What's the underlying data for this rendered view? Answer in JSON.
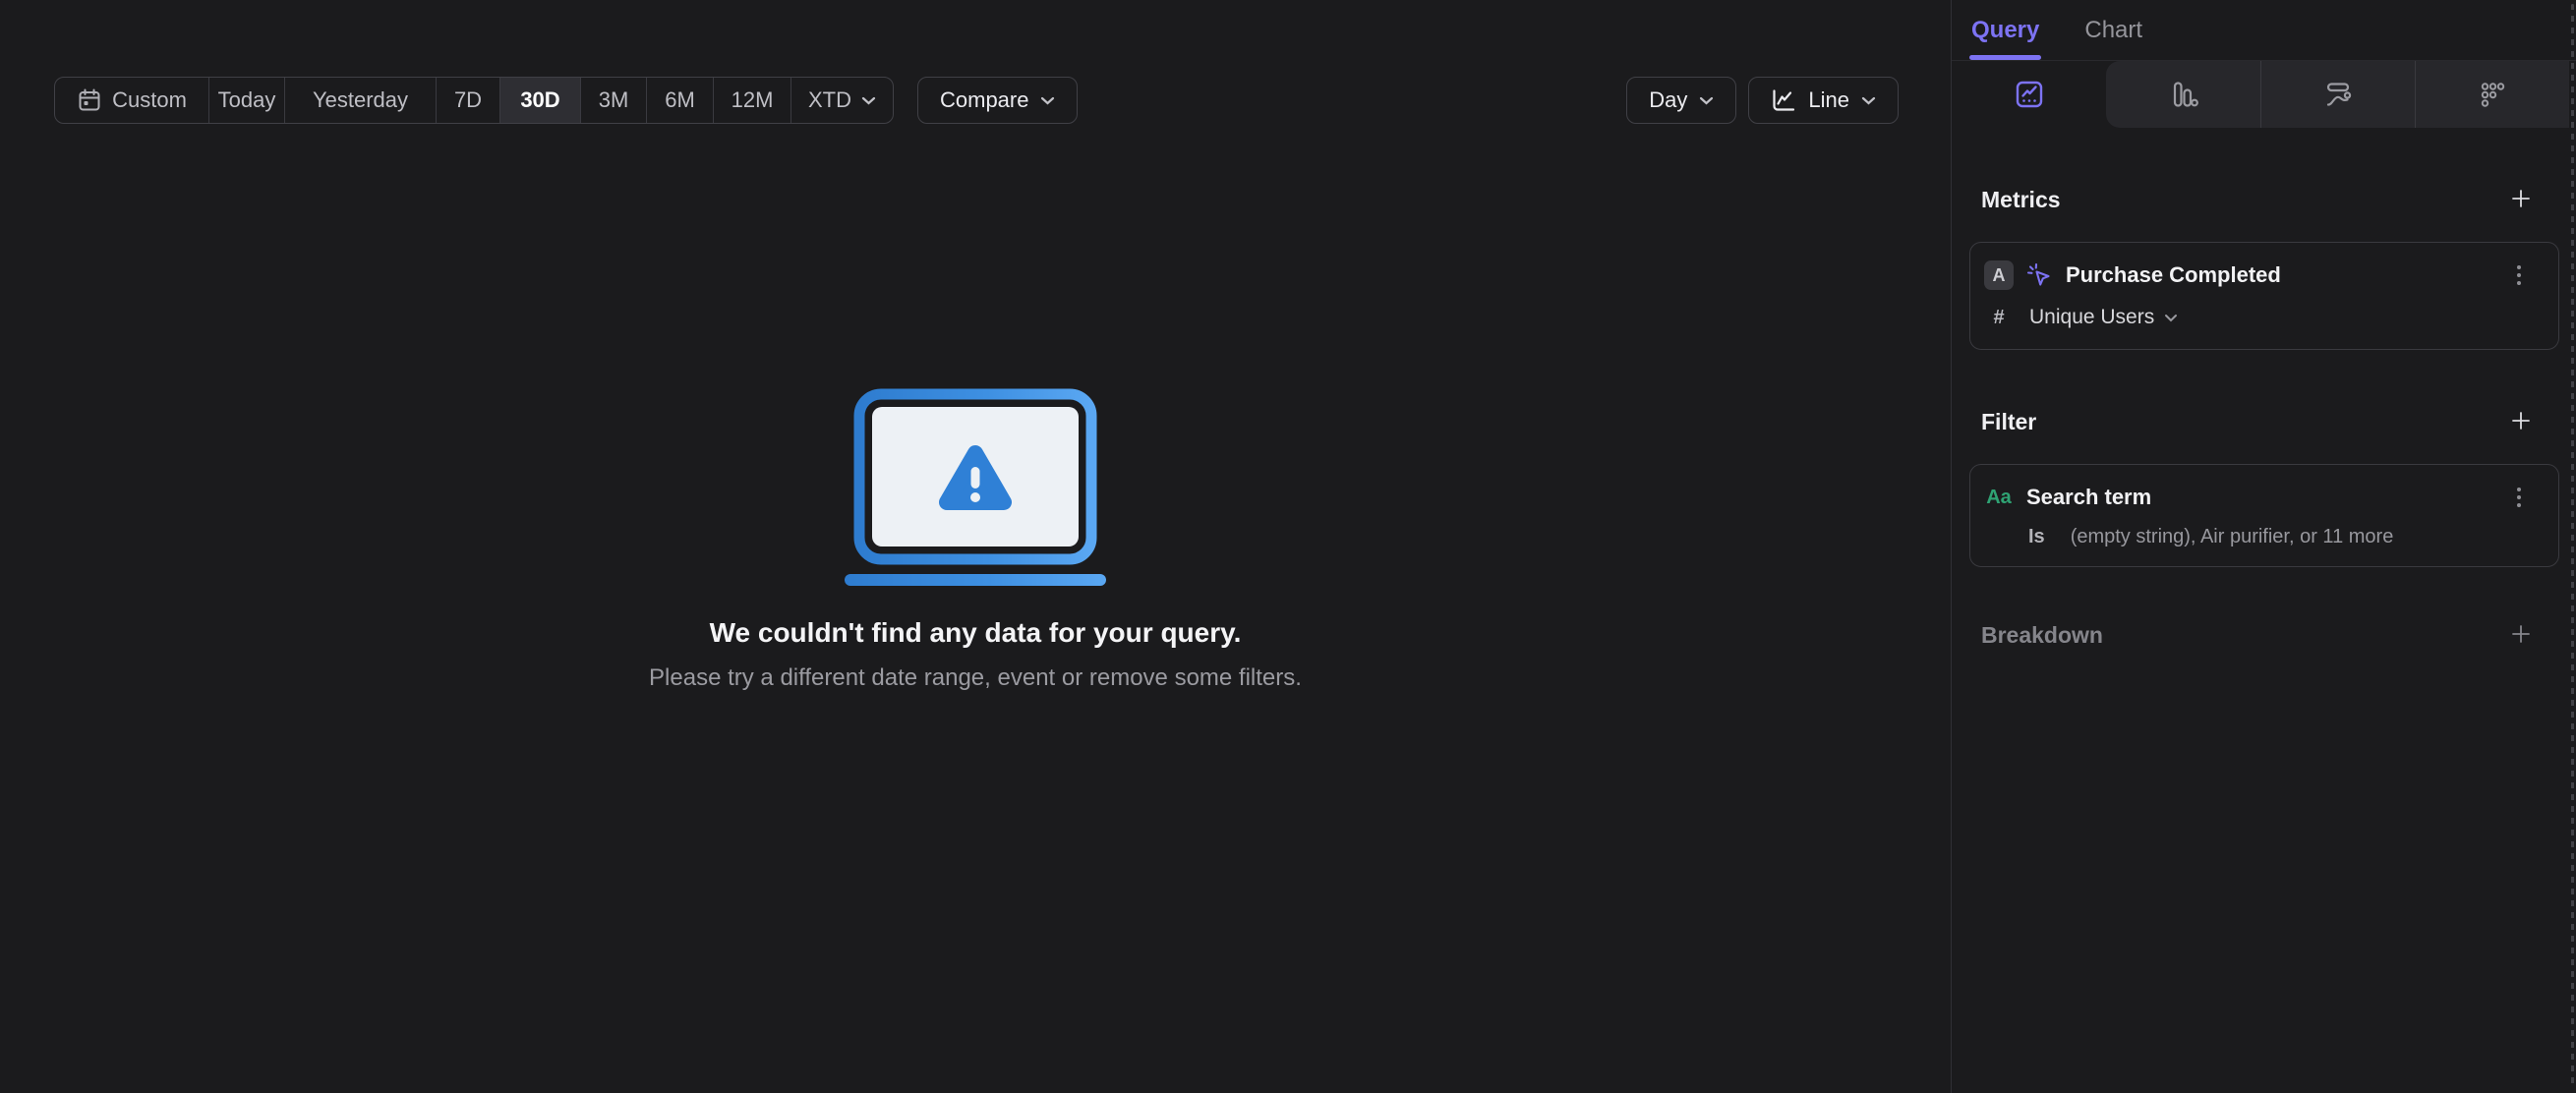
{
  "colors": {
    "accent_purple": "#7d73f3",
    "illustration_blue_dark": "#2e7ccf",
    "illustration_blue_light": "#5aa7f2",
    "illustration_screen": "#edf1f5",
    "warning_triangle_blue": "#2f80d6",
    "filter_type_green": "#2fa273",
    "selected_segment_bg": "#2e2e33",
    "background": "#1b1b1d"
  },
  "toolbar": {
    "date_presets": [
      {
        "label": "Custom",
        "icon": "calendar-icon",
        "selected": false
      },
      {
        "label": "Today",
        "selected": false
      },
      {
        "label": "Yesterday",
        "selected": false
      },
      {
        "label": "7D",
        "selected": false
      },
      {
        "label": "30D",
        "selected": true
      },
      {
        "label": "3M",
        "selected": false
      },
      {
        "label": "6M",
        "selected": false
      },
      {
        "label": "12M",
        "selected": false
      },
      {
        "label": "XTD",
        "selected": false,
        "has_dropdown": true
      }
    ],
    "selected_preset": "30D",
    "compare_label": "Compare",
    "granularity_label": "Day",
    "chart_type_label": "Line"
  },
  "empty_state": {
    "title": "We couldn't find any data for your query.",
    "subtitle": "Please try a different date range, event or remove some filters."
  },
  "sidebar": {
    "tabs": [
      {
        "label": "Query",
        "active": true
      },
      {
        "label": "Chart",
        "active": false
      }
    ],
    "report_tabs": [
      {
        "name": "insights",
        "active": true
      },
      {
        "name": "funnels",
        "active": false
      },
      {
        "name": "flows",
        "active": false
      },
      {
        "name": "retention",
        "active": false
      }
    ],
    "metrics": {
      "header": "Metrics",
      "items": [
        {
          "letter": "A",
          "event": "Purchase Completed",
          "aggregation_symbol": "#",
          "aggregation": "Unique Users"
        }
      ]
    },
    "filter": {
      "header": "Filter",
      "items": [
        {
          "type_icon": "Aa",
          "property": "Search term",
          "operator": "Is",
          "values": "(empty string), Air purifier, or 11 more"
        }
      ]
    },
    "breakdown": {
      "header": "Breakdown"
    }
  }
}
